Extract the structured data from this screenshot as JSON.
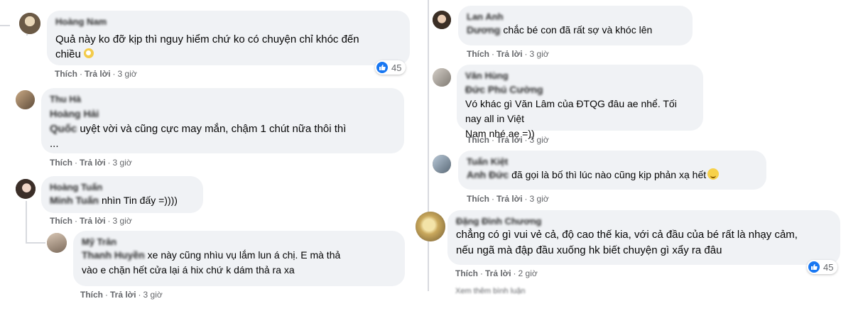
{
  "comments": [
    {
      "id": "c1",
      "author": "Hoàng Nam",
      "text": "Quả này ko đỡ kịp thì nguy hiểm chứ ko có chuyện chỉ khóc đến chiều",
      "line1": "Quả này ko đỡ kịp thì nguy hiểm chứ ko có chuyện chỉ khóc đến",
      "line2": "chiều",
      "time": "3 giờ",
      "reactions": "45"
    },
    {
      "id": "c2",
      "author": "Thu Hà",
      "quote_author": "Hoàng Hải",
      "tag": "Quốc",
      "text": "uyệt vời và cũng cực may mắn, chậm 1 chút nữa thôi thì ...",
      "line1": "uyệt vời và cũng cực may mắn, chậm 1 chút nữa thôi thì",
      "line2": "...",
      "time": "3 giờ"
    },
    {
      "id": "c3",
      "author": "Hoàng Tuấn",
      "tag": "Minh Tuấn",
      "text": "nhìn Tin đấy =))))",
      "time": "3 giờ"
    },
    {
      "id": "c4",
      "author": "Mỹ Trân",
      "tag": "Thanh Huyền",
      "text": "xe này cũng nhìu vụ lắm lun á chị. E mà thả vào e chặn hết cửa lại á hix chứ k dám thả ra xa",
      "line1": "xe này cũng nhìu vụ lắm lun á chị. E mà thả",
      "line2": "vào e chặn hết cửa lại á hix chứ k dám thả ra xa",
      "time": "3 giờ"
    },
    {
      "id": "c5",
      "author": "Lan Anh",
      "tag": "Dương",
      "text": "chắc bé con đã rất sợ và khóc lên",
      "time": "3 giờ"
    },
    {
      "id": "c6",
      "author": "Văn Hùng",
      "quote_author": "Đức Phú Cường",
      "text": "Vó khác gì Văn Lâm của ĐTQG đâu ae nhể. Tối nay all in Việt Nam nhé ae =))",
      "line1": "Vó khác gì Văn Lâm của ĐTQG đâu ae nhể. Tối nay all in Việt",
      "line2": "Nam nhé ae =))",
      "time": "3 giờ"
    },
    {
      "id": "c7",
      "author": "Tuấn Kiệt",
      "tag": "Anh Đức",
      "text": "đã gọi là bố thì lúc nào cũng kịp phản xạ hết",
      "time": "3 giờ"
    },
    {
      "id": "c8",
      "author": "Đặng Đình Chương",
      "text": "chẳng có gì vui vẻ cả, độ cao thế kia, với cả đầu của bé rất là nhạy cảm, nếu ngã mà đập đầu xuống hk biết chuyện gì xẩy ra đâu",
      "line1": "chẳng có gì vui vẻ cả, độ cao thế kia, với cả đầu của bé rất là nhạy cảm,",
      "line2": "nếu ngã mà đập đầu xuống hk biết chuyện gì xẩy ra đâu",
      "time": "2 giờ",
      "reactions": "45"
    }
  ],
  "labels": {
    "like": "Thích",
    "reply": "Trả lời",
    "dot": "·"
  },
  "partial_row": "Xem thêm bình luận",
  "colors": {
    "bubble": "#f0f2f5",
    "meta": "#65676b",
    "like": "#1877f2"
  }
}
